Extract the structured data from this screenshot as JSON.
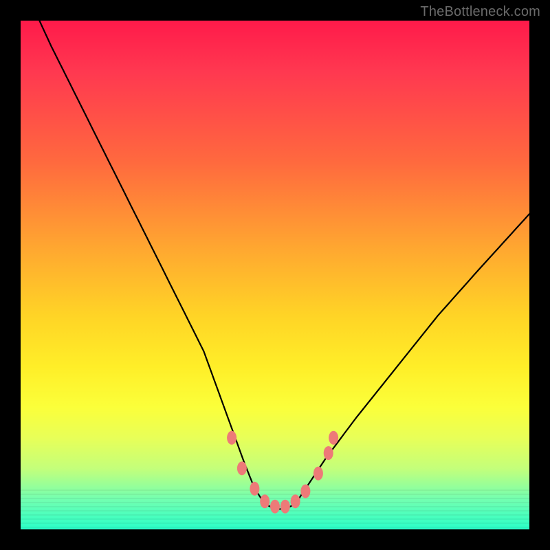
{
  "watermark": {
    "text": "TheBottleneck.com"
  },
  "chart_data": {
    "type": "line",
    "title": "",
    "xlabel": "",
    "ylabel": "",
    "xlim": [
      0,
      100
    ],
    "ylim": [
      0,
      100
    ],
    "series": [
      {
        "name": "bottleneck-curve",
        "x": [
          0,
          6,
          12,
          18,
          24,
          30,
          36,
          40,
          44,
          46,
          48,
          50,
          52,
          54,
          56,
          60,
          66,
          74,
          82,
          90,
          100
        ],
        "values": [
          108,
          95,
          83,
          71,
          59,
          47,
          35,
          24,
          13,
          8,
          5,
          4,
          4,
          5,
          8,
          14,
          22,
          32,
          42,
          51,
          62
        ]
      }
    ],
    "markers": {
      "name": "highlight-dots",
      "color": "#ed7a78",
      "points": [
        {
          "x": 41.5,
          "y": 18
        },
        {
          "x": 43.5,
          "y": 12
        },
        {
          "x": 46.0,
          "y": 8
        },
        {
          "x": 48.0,
          "y": 5.5
        },
        {
          "x": 50.0,
          "y": 4.5
        },
        {
          "x": 52.0,
          "y": 4.5
        },
        {
          "x": 54.0,
          "y": 5.5
        },
        {
          "x": 56.0,
          "y": 7.5
        },
        {
          "x": 58.5,
          "y": 11
        },
        {
          "x": 60.5,
          "y": 15
        },
        {
          "x": 61.5,
          "y": 18
        }
      ]
    },
    "gradient_stops": [
      {
        "pos": 0.0,
        "color": "#ff1a4a"
      },
      {
        "pos": 0.28,
        "color": "#ff6a3e"
      },
      {
        "pos": 0.58,
        "color": "#ffd426"
      },
      {
        "pos": 0.82,
        "color": "#e8ff58"
      },
      {
        "pos": 1.0,
        "color": "#2affc8"
      }
    ]
  }
}
